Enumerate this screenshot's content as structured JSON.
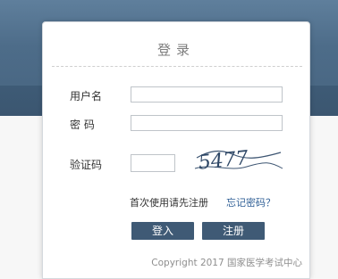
{
  "login": {
    "title": "登录",
    "username_label": "用户名",
    "username_value": "",
    "password_label": "密 码",
    "password_value": "",
    "captcha_label": "验证码",
    "captcha_value": "",
    "captcha_text": "5477",
    "register_hint": "首次使用请先注册",
    "forgot_link": "忘记密码？",
    "login_button": "登入",
    "register_button": "注册",
    "copyright": "Copyright 2017 国家医学考试中心"
  },
  "colors": {
    "header_background": "#4d6c89",
    "button_background": "#3f5a75",
    "link": "#2f5f96"
  }
}
